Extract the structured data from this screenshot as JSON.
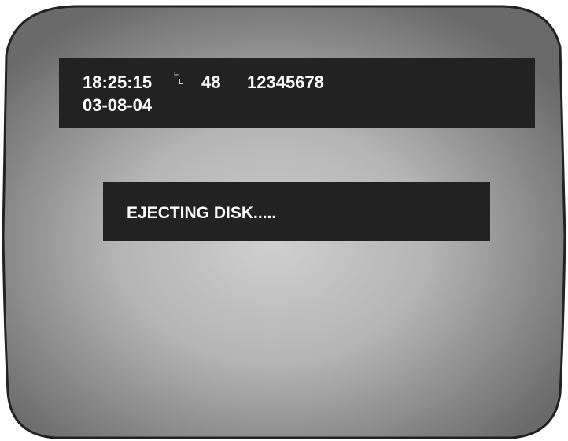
{
  "colors": {
    "bezel": "#555555",
    "screen_center": "#cfcfcf",
    "screen_edge": "#6a6a6a",
    "osd_background": "#222222",
    "osd_text": "#ffffff"
  },
  "status_bar": {
    "time": "18:25:15",
    "mode_top": "F",
    "mode_bottom": "L",
    "channel": "48",
    "camera_id": "12345678",
    "date": "03-08-04"
  },
  "message": {
    "text": "EJECTING DISK....."
  }
}
